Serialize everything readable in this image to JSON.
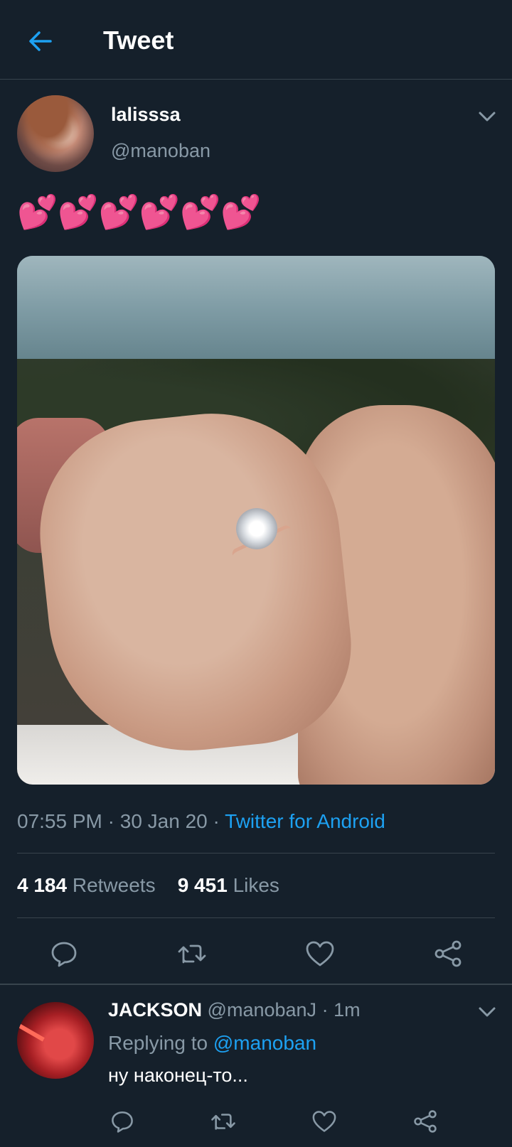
{
  "header": {
    "title": "Tweet",
    "back_icon": "arrow-left-icon",
    "accent": "#1da1f2"
  },
  "tweet": {
    "author": {
      "name": "lalisssa",
      "handle": "@manoban",
      "avatar": "woman-selfie-avatar"
    },
    "text": "💕💕💕💕💕💕",
    "media": {
      "description_icon": "photo-engagement-ring-hands"
    },
    "meta": {
      "time": "07:55 PM",
      "date": "30 Jan 20",
      "separator": "·",
      "source": "Twitter for Android"
    },
    "stats": {
      "retweets_count": "4 184",
      "retweets_label": "Retweets",
      "likes_count": "9 451",
      "likes_label": "Likes"
    },
    "actions": [
      "reply-icon",
      "retweet-icon",
      "like-heart-icon",
      "share-icon"
    ]
  },
  "reply": {
    "name": "JACKSON",
    "handle": "@manobanJ",
    "separator": "·",
    "time": "1m",
    "replying_prefix": "Replying to",
    "replying_to": "@manoban",
    "text": "ну наконец-то...",
    "avatar": "man-red-lighting-avatar",
    "actions": [
      "reply-icon",
      "retweet-icon",
      "like-heart-icon",
      "share-icon"
    ]
  },
  "colors": {
    "background": "#15202b",
    "divider": "#38444d",
    "secondary_text": "#8899a6",
    "link": "#1da1f2",
    "emoji_hearts": "#e0245e"
  }
}
